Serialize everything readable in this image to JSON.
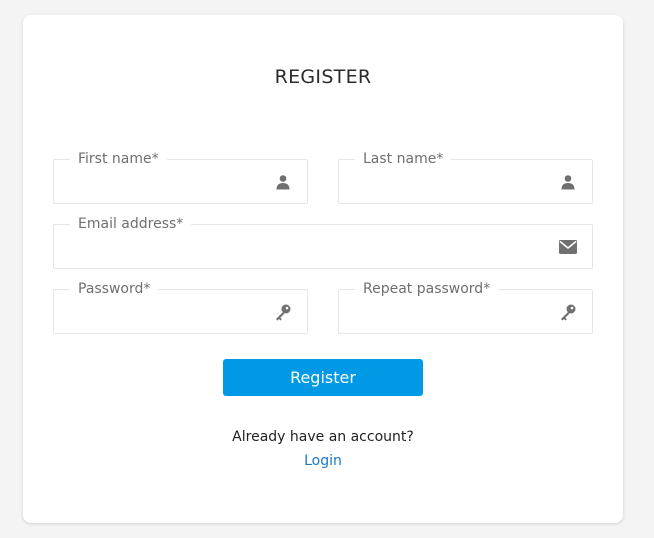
{
  "form": {
    "title": "REGISTER",
    "first_name": {
      "label": "First name*",
      "value": "",
      "icon": "user-icon"
    },
    "last_name": {
      "label": "Last name*",
      "value": "",
      "icon": "user-icon"
    },
    "email": {
      "label": "Email address*",
      "value": "",
      "icon": "envelope-icon"
    },
    "password": {
      "label": "Password*",
      "value": "",
      "icon": "key-icon"
    },
    "repeat_password": {
      "label": "Repeat password*",
      "value": "",
      "icon": "key-icon"
    },
    "submit_label": "Register"
  },
  "footer": {
    "prompt": "Already have an account?",
    "login_label": "Login"
  },
  "colors": {
    "page_background": "#f4f4f4",
    "card_background": "#ffffff",
    "primary_button": "#0099e6",
    "link": "#1a78c8",
    "icon": "#707070",
    "field_border": "#e6e6e6"
  }
}
